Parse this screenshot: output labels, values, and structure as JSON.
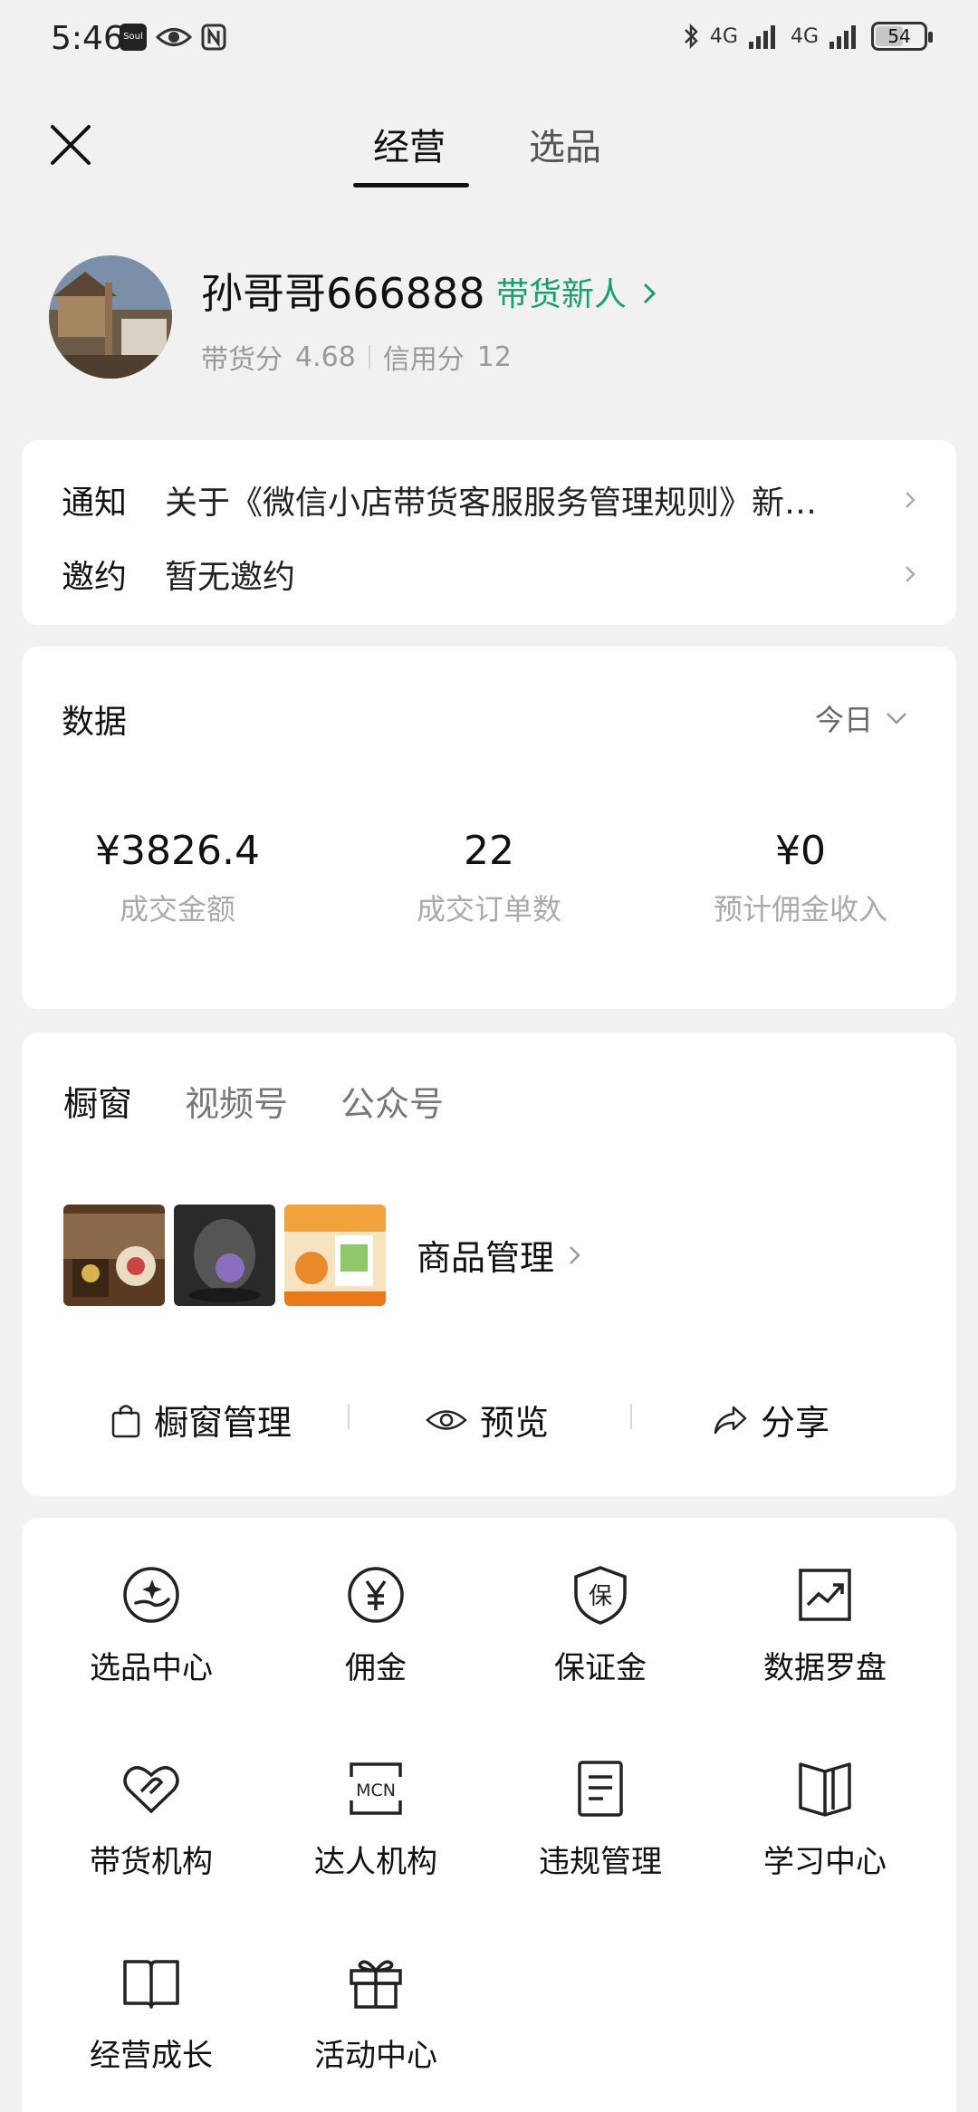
{
  "status_bar": {
    "time": "5:46",
    "app_icon_text": "Soul",
    "network_1": "4G",
    "network_2": "4G",
    "battery": "54"
  },
  "header": {
    "tabs": [
      {
        "label": "经营",
        "active": true
      },
      {
        "label": "选品",
        "active": false
      }
    ]
  },
  "profile": {
    "name": "孙哥哥666888",
    "badge": "带货新人",
    "sales_score_label": "带货分",
    "sales_score": "4.68",
    "credit_score_label": "信用分",
    "credit_score": "12"
  },
  "notices": [
    {
      "label": "通知",
      "text": "关于《微信小店带货客服服务管理规则》新…"
    },
    {
      "label": "邀约",
      "text": "暂无邀约"
    }
  ],
  "data_section": {
    "title": "数据",
    "range": "今日",
    "stats": [
      {
        "value": "¥3826.4",
        "label": "成交金额"
      },
      {
        "value": "22",
        "label": "成交订单数"
      },
      {
        "value": "¥0",
        "label": "预计佣金收入"
      }
    ]
  },
  "window_section": {
    "tabs": [
      {
        "label": "橱窗",
        "active": true
      },
      {
        "label": "视频号",
        "active": false
      },
      {
        "label": "公众号",
        "active": false
      }
    ],
    "product_manage": "商品管理",
    "actions": [
      {
        "label": "橱窗管理",
        "icon": "shopping-bag-icon"
      },
      {
        "label": "预览",
        "icon": "eye-icon"
      },
      {
        "label": "分享",
        "icon": "share-icon"
      }
    ]
  },
  "grid": [
    {
      "label": "选品中心",
      "icon": "hand-sparkle-icon"
    },
    {
      "label": "佣金",
      "icon": "yen-icon"
    },
    {
      "label": "保证金",
      "icon": "shield-bao-icon"
    },
    {
      "label": "数据罗盘",
      "icon": "trend-chart-icon"
    },
    {
      "label": "带货机构",
      "icon": "heart-handshake-icon"
    },
    {
      "label": "达人机构",
      "icon": "mcn-icon"
    },
    {
      "label": "违规管理",
      "icon": "document-icon"
    },
    {
      "label": "学习中心",
      "icon": "open-book-icon"
    },
    {
      "label": "经营成长",
      "icon": "book-icon"
    },
    {
      "label": "活动中心",
      "icon": "gift-icon"
    }
  ],
  "colors": {
    "accent_green": "#17a070",
    "background": "#f1f1f1",
    "muted_text": "#aaaaaa"
  }
}
